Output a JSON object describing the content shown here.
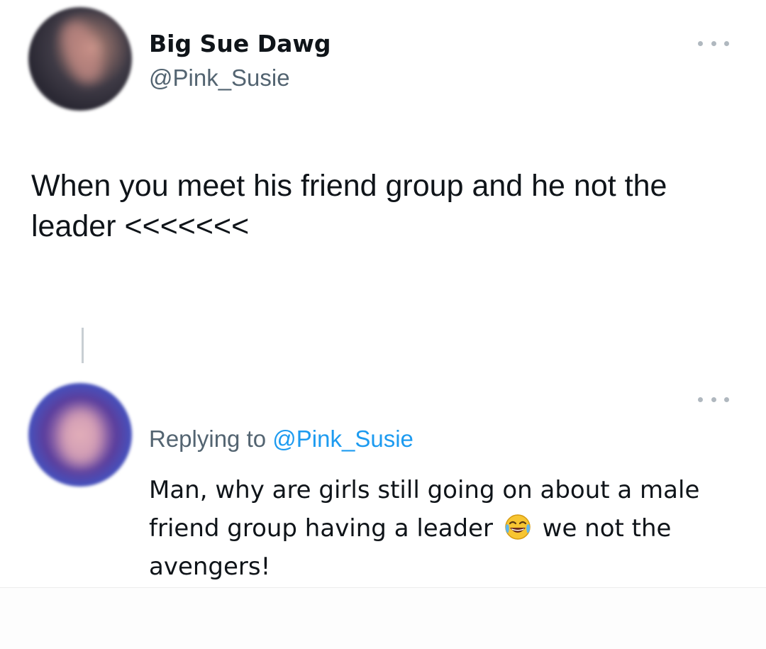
{
  "tweet": {
    "author": {
      "display_name": "Big Sue Dawg",
      "handle": "@Pink_Susie"
    },
    "text": "When you meet his friend group and he not the leader <<<<<<<",
    "more_icon": "more-horizontal-icon"
  },
  "reply": {
    "replying_prefix": "Replying to",
    "replying_handle": "@Pink_Susie",
    "text_before_emoji": "Man, why are girls still going on about a male friend group having a leader",
    "emoji": "face-with-tears-of-joy-icon",
    "text_after_emoji": "we not the avengers!",
    "more_icon": "more-horizontal-icon"
  },
  "colors": {
    "text": "#0f1419",
    "secondary_text": "#536471",
    "link": "#1d9bf0",
    "thread_line": "#c8ced3"
  }
}
